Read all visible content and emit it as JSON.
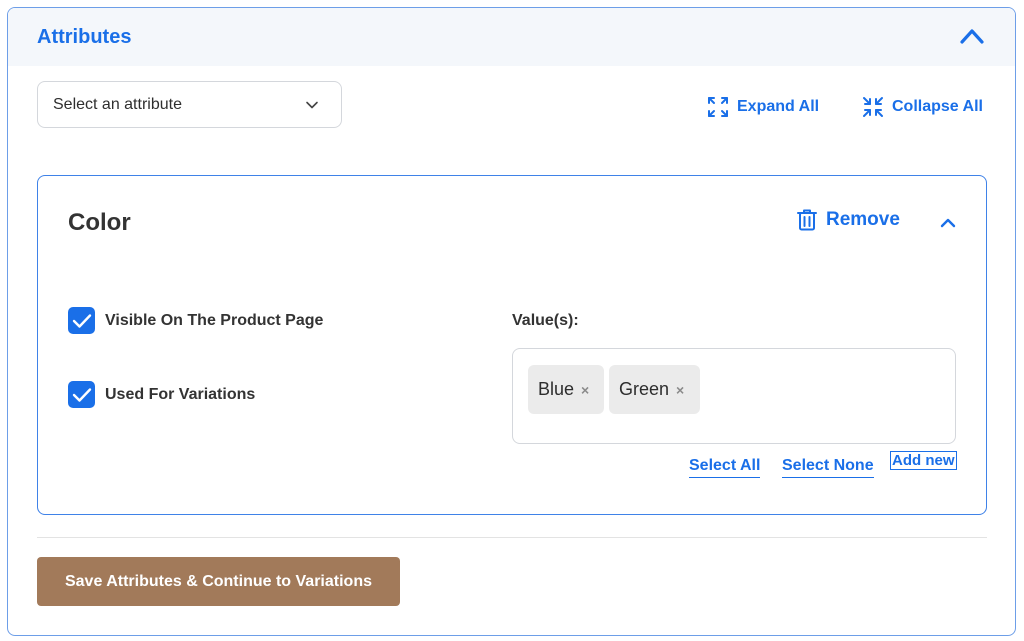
{
  "panel": {
    "title": "Attributes",
    "toggle_icon": "chevron-up-icon"
  },
  "toolbar": {
    "select_placeholder": "Select an attribute",
    "expand_all_label": "Expand All",
    "collapse_all_label": "Collapse All"
  },
  "attribute": {
    "name": "Color",
    "remove_label": "Remove",
    "visible_label": "Visible On The Product Page",
    "visible_checked": true,
    "variations_label": "Used For Variations",
    "variations_checked": true,
    "values_label": "Value(s):",
    "values": [
      {
        "label": "Blue",
        "remove_glyph": "×"
      },
      {
        "label": "Green",
        "remove_glyph": "×"
      }
    ],
    "select_all_label": "Select All",
    "select_none_label": "Select None",
    "add_new_label": "Add new"
  },
  "footer": {
    "save_label": "Save Attributes & Continue to Variations"
  },
  "colors": {
    "accent": "#1a6fe8",
    "save_button": "#a27a5a",
    "border": "#3f82e8"
  }
}
